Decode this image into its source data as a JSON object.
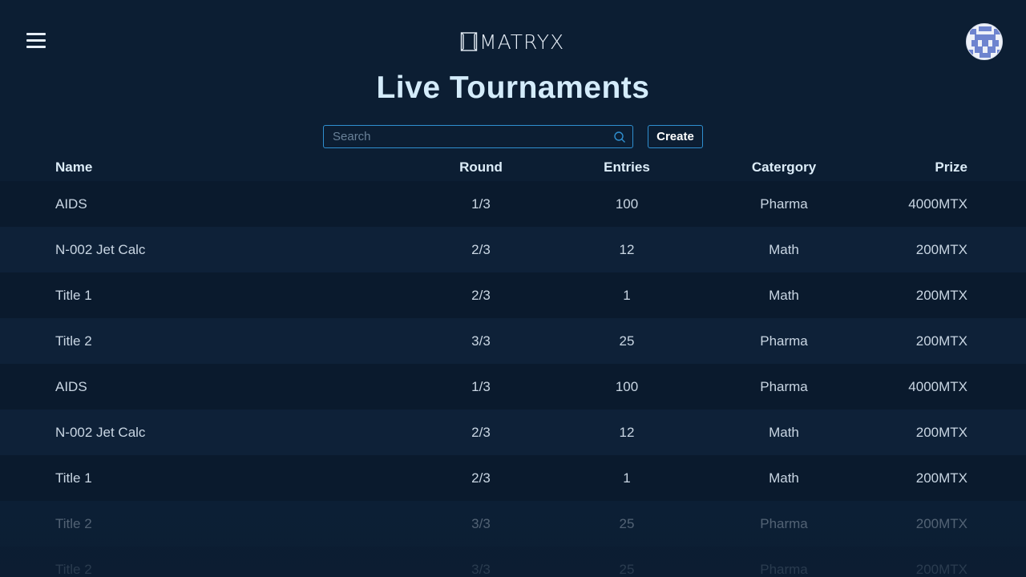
{
  "header": {
    "logo_text": "MATRYX",
    "accent_color": "#2f8fd0"
  },
  "page": {
    "title": "Live Tournaments"
  },
  "search": {
    "placeholder": "Search",
    "value": ""
  },
  "actions": {
    "create_label": "Create"
  },
  "table": {
    "columns": {
      "name": "Name",
      "round": "Round",
      "entries": "Entries",
      "category": "Catergory",
      "prize": "Prize"
    },
    "rows": [
      {
        "name": "AIDS",
        "round": "1/3",
        "entries": "100",
        "category": "Pharma",
        "prize": "4000MTX"
      },
      {
        "name": "N-002 Jet Calc",
        "round": "2/3",
        "entries": "12",
        "category": "Math",
        "prize": "200MTX"
      },
      {
        "name": "Title 1",
        "round": "2/3",
        "entries": "1",
        "category": "Math",
        "prize": "200MTX"
      },
      {
        "name": "Title 2",
        "round": "3/3",
        "entries": "25",
        "category": "Pharma",
        "prize": "200MTX"
      },
      {
        "name": "AIDS",
        "round": "1/3",
        "entries": "100",
        "category": "Pharma",
        "prize": "4000MTX"
      },
      {
        "name": "N-002 Jet Calc",
        "round": "2/3",
        "entries": "12",
        "category": "Math",
        "prize": "200MTX"
      },
      {
        "name": "Title 1",
        "round": "2/3",
        "entries": "1",
        "category": "Math",
        "prize": "200MTX"
      },
      {
        "name": "Title 2",
        "round": "3/3",
        "entries": "25",
        "category": "Pharma",
        "prize": "200MTX"
      },
      {
        "name": "Title 2",
        "round": "3/3",
        "entries": "25",
        "category": "Pharma",
        "prize": "200MTX"
      }
    ]
  }
}
